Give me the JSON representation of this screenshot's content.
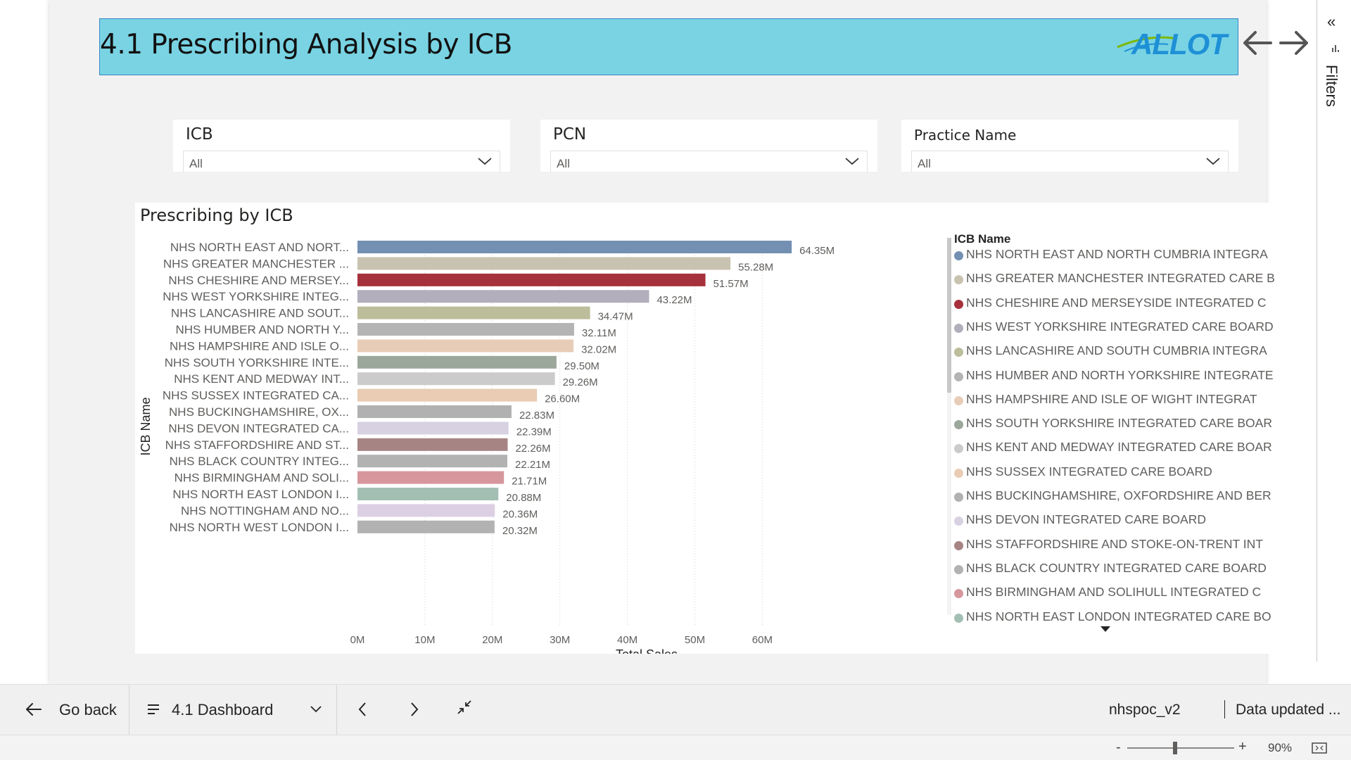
{
  "header": {
    "title": "4.1 Prescribing Analysis by ICB",
    "logo_text": "ALLOT",
    "logo_icon": "allot-logo",
    "nav_back_icon": "arrow-left-icon",
    "nav_forward_icon": "arrow-right-icon",
    "title_bg_color": "#79d3e3"
  },
  "slicers": [
    {
      "label": "ICB",
      "value": "All"
    },
    {
      "label": "PCN",
      "value": "All"
    },
    {
      "label": "Practice Name",
      "value": "All"
    }
  ],
  "visual": {
    "title": "Prescribing by ICB"
  },
  "chart_data": {
    "type": "bar",
    "orientation": "horizontal",
    "title": "Prescribing by ICB",
    "xlabel": "Total Sales",
    "ylabel": "ICB Name",
    "xlim": [
      0,
      65000000
    ],
    "x_ticks": [
      "0M",
      "10M",
      "20M",
      "30M",
      "40M",
      "50M",
      "60M"
    ],
    "x_tick_values": [
      0,
      10000000,
      20000000,
      30000000,
      40000000,
      50000000,
      60000000
    ],
    "grid": "vertical dotted",
    "categories": [
      "NHS NORTH EAST AND NORT...",
      "NHS GREATER MANCHESTER ...",
      "NHS CHESHIRE AND MERSEY...",
      "NHS WEST YORKSHIRE INTEG...",
      "NHS LANCASHIRE AND SOUT...",
      "NHS HUMBER AND NORTH Y...",
      "NHS HAMPSHIRE AND ISLE O...",
      "NHS SOUTH YORKSHIRE INTE...",
      "NHS KENT AND MEDWAY INT...",
      "NHS SUSSEX INTEGRATED CA...",
      "NHS BUCKINGHAMSHIRE, OX...",
      "NHS DEVON INTEGRATED CA...",
      "NHS STAFFORDSHIRE AND ST...",
      "NHS BLACK COUNTRY INTEG...",
      "NHS BIRMINGHAM AND SOLI...",
      "NHS NORTH EAST LONDON I...",
      "NHS NOTTINGHAM AND NO...",
      "NHS NORTH WEST LONDON I..."
    ],
    "values": [
      64350000,
      55280000,
      51570000,
      43220000,
      34470000,
      32110000,
      32020000,
      29500000,
      29260000,
      26600000,
      22830000,
      22390000,
      22260000,
      22210000,
      21710000,
      20880000,
      20360000,
      20320000
    ],
    "data_labels": [
      "64.35M",
      "55.28M",
      "51.57M",
      "43.22M",
      "34.47M",
      "32.11M",
      "32.02M",
      "29.50M",
      "29.26M",
      "26.60M",
      "22.83M",
      "22.39M",
      "22.26M",
      "22.21M",
      "21.71M",
      "20.88M",
      "20.36M",
      "20.32M"
    ],
    "colors": [
      "#7390b3",
      "#c8c2b0",
      "#a6303b",
      "#b2aebc",
      "#bcbd9a",
      "#b4b4b4",
      "#e7cdb8",
      "#9ca79c",
      "#cbcbcb",
      "#e9ccb3",
      "#b1b1b1",
      "#d7d1e1",
      "#a68484",
      "#b2b2b2",
      "#d6979c",
      "#a3bfb3",
      "#dccfe3",
      "#b2b2b2"
    ],
    "legend": {
      "title": "ICB Name",
      "placement": "right",
      "entries": [
        "NHS NORTH EAST AND NORTH CUMBRIA INTEGRA",
        "NHS GREATER MANCHESTER INTEGRATED CARE B",
        "NHS CHESHIRE AND MERSEYSIDE INTEGRATED C",
        "NHS WEST YORKSHIRE INTEGRATED CARE BOARD",
        "NHS LANCASHIRE AND SOUTH CUMBRIA INTEGRA",
        "NHS HUMBER AND NORTH YORKSHIRE INTEGRATE",
        "NHS HAMPSHIRE AND ISLE OF WIGHT INTEGRAT",
        "NHS SOUTH YORKSHIRE INTEGRATED CARE BOAR",
        "NHS KENT AND MEDWAY INTEGRATED CARE BOAR",
        "NHS SUSSEX INTEGRATED CARE BOARD",
        "NHS BUCKINGHAMSHIRE, OXFORDSHIRE AND BER",
        "NHS DEVON INTEGRATED CARE BOARD",
        "NHS STAFFORDSHIRE AND STOKE-ON-TRENT INT",
        "NHS BLACK COUNTRY INTEGRATED CARE BOARD",
        "NHS BIRMINGHAM AND SOLIHULL INTEGRATED C",
        "NHS NORTH EAST LONDON INTEGRATED CARE BO"
      ]
    }
  },
  "filters_pane": {
    "label": "Filters",
    "collapse_glyph": "«",
    "collapse_icon": "double-chevron-left-icon",
    "filter_icon": "filter-icon"
  },
  "bottom_bar": {
    "go_back_label": "Go back",
    "page_name": "4.1 Dashboard",
    "dataset_name": "nhspoc_v2",
    "data_updated": "Data updated ..."
  },
  "status_bar": {
    "zoom_minus": "-",
    "zoom_plus": "+",
    "zoom_level": "90%",
    "zoom_value": 0.45
  }
}
